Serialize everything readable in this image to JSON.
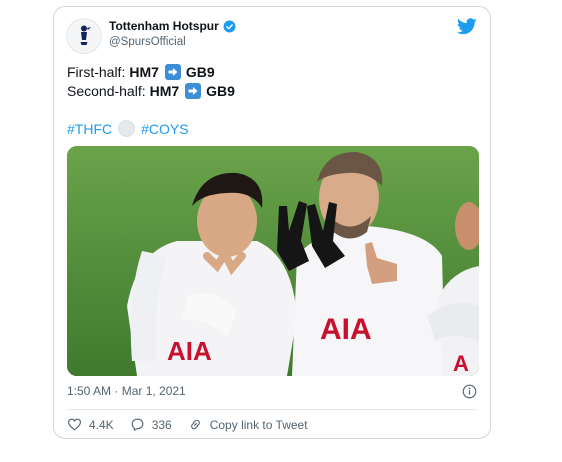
{
  "tweet": {
    "author_name": "Tottenham Hotspur",
    "author_handle": "@SpursOfficial",
    "verified": true,
    "lines": [
      {
        "label": "First-half:",
        "from": "HM7",
        "to": "GB9"
      },
      {
        "label": "Second-half:",
        "from": "HM7",
        "to": "GB9"
      }
    ],
    "hashtags": [
      "#THFC",
      "#COYS"
    ],
    "media": {
      "shirt_text_left": "AIA",
      "shirt_text_right": "AIA",
      "shirt_text_far_right": "A"
    },
    "timestamp": "1:50 AM · Mar 1, 2021",
    "likes": "4.4K",
    "replies": "336",
    "copy_link_label": "Copy link to Tweet"
  },
  "icons": {
    "brand": "twitter-bird-icon",
    "verified": "verified-badge-icon",
    "arrow": "right-arrow-icon",
    "ball": "soccer-ball-icon",
    "info": "info-icon",
    "like": "heart-icon",
    "reply": "reply-icon",
    "link": "link-icon"
  },
  "colors": {
    "accent": "#1d9bf0",
    "text": "#0f1419",
    "muted": "#536471",
    "border": "#cfd9de"
  }
}
